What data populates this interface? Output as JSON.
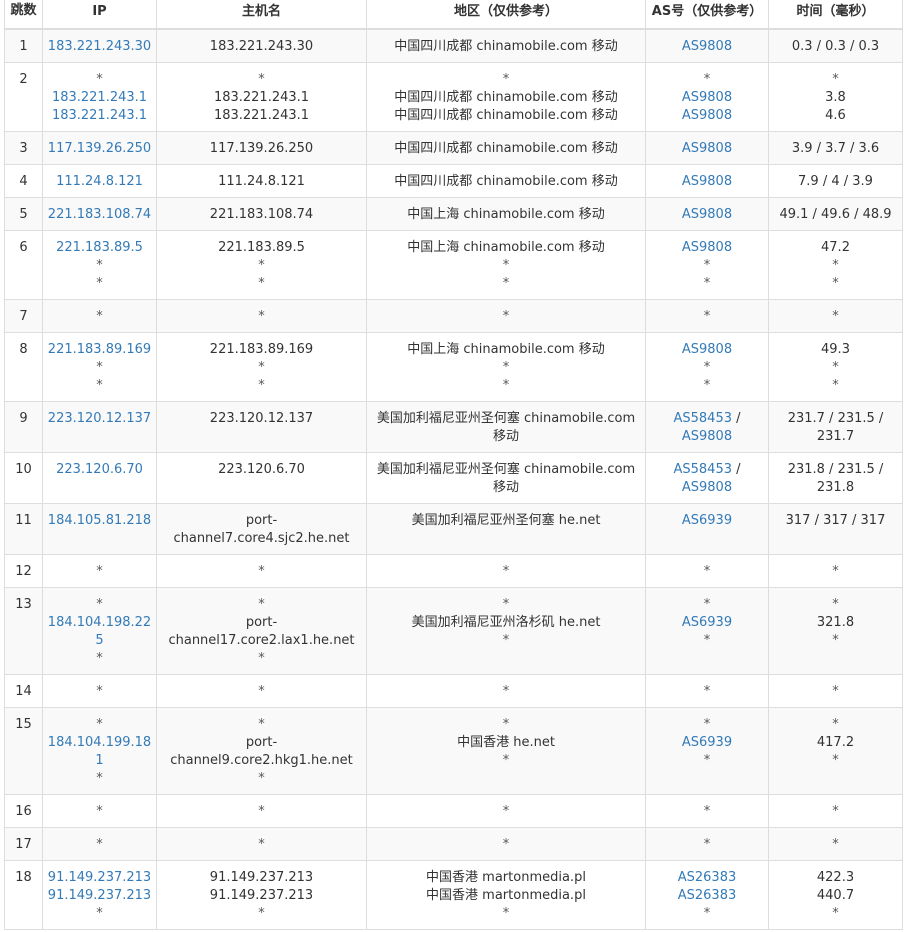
{
  "headers": {
    "hop": "跳数",
    "ip": "IP",
    "hostname": "主机名",
    "location": "地区（仅供参考）",
    "as": "AS号（仅供参考）",
    "time": "时间（毫秒）"
  },
  "rows": [
    {
      "hop": "1",
      "ip": [
        "183.221.243.30"
      ],
      "host": [
        "183.221.243.30"
      ],
      "loc": [
        "中国四川成都 chinamobile.com 移动"
      ],
      "as": [
        "AS9808"
      ],
      "time": [
        "0.3 / 0.3 / 0.3"
      ]
    },
    {
      "hop": "2",
      "ip": [
        "*",
        "183.221.243.1",
        "183.221.243.1"
      ],
      "host": [
        "*",
        "183.221.243.1",
        "183.221.243.1"
      ],
      "loc": [
        "*",
        "中国四川成都 chinamobile.com 移动",
        "中国四川成都 chinamobile.com 移动"
      ],
      "as": [
        "*",
        "AS9808",
        "AS9808"
      ],
      "time": [
        "*",
        "3.8",
        "4.6"
      ]
    },
    {
      "hop": "3",
      "ip": [
        "117.139.26.250"
      ],
      "host": [
        "117.139.26.250"
      ],
      "loc": [
        "中国四川成都 chinamobile.com 移动"
      ],
      "as": [
        "AS9808"
      ],
      "time": [
        "3.9 / 3.7 / 3.6"
      ]
    },
    {
      "hop": "4",
      "ip": [
        "111.24.8.121"
      ],
      "host": [
        "111.24.8.121"
      ],
      "loc": [
        "中国四川成都 chinamobile.com 移动"
      ],
      "as": [
        "AS9808"
      ],
      "time": [
        "7.9 / 4 / 3.9"
      ]
    },
    {
      "hop": "5",
      "ip": [
        "221.183.108.74"
      ],
      "host": [
        "221.183.108.74"
      ],
      "loc": [
        "中国上海 chinamobile.com 移动"
      ],
      "as": [
        "AS9808"
      ],
      "time": [
        "49.1 / 49.6 / 48.9"
      ]
    },
    {
      "hop": "6",
      "ip": [
        "221.183.89.5",
        "*",
        "*"
      ],
      "host": [
        "221.183.89.5",
        "*",
        "*"
      ],
      "loc": [
        "中国上海 chinamobile.com 移动",
        "*",
        "*"
      ],
      "as": [
        "AS9808",
        "*",
        "*"
      ],
      "time": [
        "47.2",
        "*",
        "*"
      ]
    },
    {
      "hop": "7",
      "ip": [
        "*"
      ],
      "host": [
        "*"
      ],
      "loc": [
        "*"
      ],
      "as": [
        "*"
      ],
      "time": [
        "*"
      ]
    },
    {
      "hop": "8",
      "ip": [
        "221.183.89.169",
        "*",
        "*"
      ],
      "host": [
        "221.183.89.169",
        "*",
        "*"
      ],
      "loc": [
        "中国上海 chinamobile.com 移动",
        "*",
        "*"
      ],
      "as": [
        "AS9808",
        "*",
        "*"
      ],
      "time": [
        "49.3",
        "*",
        "*"
      ]
    },
    {
      "hop": "9",
      "ip": [
        "223.120.12.137"
      ],
      "host": [
        "223.120.12.137"
      ],
      "loc": [
        "美国加利福尼亚州圣何塞 chinamobile.com 移动"
      ],
      "as": [
        "AS58453 / AS9808"
      ],
      "as_parts": [
        "AS58453",
        "AS9808"
      ],
      "time": [
        "231.7 / 231.5 / 231.7"
      ]
    },
    {
      "hop": "10",
      "ip": [
        "223.120.6.70"
      ],
      "host": [
        "223.120.6.70"
      ],
      "loc": [
        "美国加利福尼亚州圣何塞 chinamobile.com 移动"
      ],
      "as": [
        "AS58453 / AS9808"
      ],
      "as_parts": [
        "AS58453",
        "AS9808"
      ],
      "time": [
        "231.8 / 231.5 / 231.8"
      ]
    },
    {
      "hop": "11",
      "ip": [
        "184.105.81.218"
      ],
      "host": [
        "port-channel7.core4.sjc2.he.net"
      ],
      "loc": [
        "美国加利福尼亚州圣何塞 he.net"
      ],
      "as": [
        "AS6939"
      ],
      "time": [
        "317 / 317 / 317"
      ]
    },
    {
      "hop": "12",
      "ip": [
        "*"
      ],
      "host": [
        "*"
      ],
      "loc": [
        "*"
      ],
      "as": [
        "*"
      ],
      "time": [
        "*"
      ]
    },
    {
      "hop": "13",
      "ip": [
        "*",
        "184.104.198.225",
        "*"
      ],
      "host": [
        "*",
        "port-channel17.core2.lax1.he.net",
        "*"
      ],
      "loc": [
        "*",
        "美国加利福尼亚州洛杉矶 he.net",
        "*"
      ],
      "as": [
        "*",
        "AS6939",
        "*"
      ],
      "time": [
        "*",
        "321.8",
        "*"
      ]
    },
    {
      "hop": "14",
      "ip": [
        "*"
      ],
      "host": [
        "*"
      ],
      "loc": [
        "*"
      ],
      "as": [
        "*"
      ],
      "time": [
        "*"
      ]
    },
    {
      "hop": "15",
      "ip": [
        "*",
        "184.104.199.181",
        "*"
      ],
      "host": [
        "*",
        "port-channel9.core2.hkg1.he.net",
        "*"
      ],
      "loc": [
        "*",
        "中国香港 he.net",
        "*"
      ],
      "as": [
        "*",
        "AS6939",
        "*"
      ],
      "time": [
        "*",
        "417.2",
        "*"
      ]
    },
    {
      "hop": "16",
      "ip": [
        "*"
      ],
      "host": [
        "*"
      ],
      "loc": [
        "*"
      ],
      "as": [
        "*"
      ],
      "time": [
        "*"
      ]
    },
    {
      "hop": "17",
      "ip": [
        "*"
      ],
      "host": [
        "*"
      ],
      "loc": [
        "*"
      ],
      "as": [
        "*"
      ],
      "time": [
        "*"
      ]
    },
    {
      "hop": "18",
      "ip": [
        "91.149.237.213",
        "91.149.237.213",
        "*"
      ],
      "host": [
        "91.149.237.213",
        "91.149.237.213",
        "*"
      ],
      "loc": [
        "中国香港 martonmedia.pl",
        "中国香港 martonmedia.pl",
        "*"
      ],
      "as": [
        "AS26383",
        "AS26383",
        "*"
      ],
      "time": [
        "422.3",
        "440.7",
        "*"
      ]
    }
  ],
  "colors": {
    "link": "#337ab7",
    "text": "#333333",
    "border": "#dddddd",
    "stripe": "#f9f9f9"
  }
}
